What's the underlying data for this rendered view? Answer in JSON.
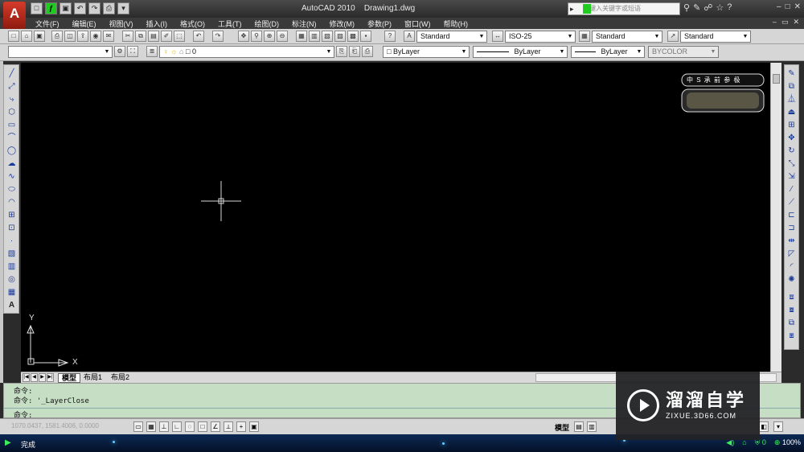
{
  "app": {
    "title": "AutoCAD 2010",
    "file": "Drawing1.dwg",
    "search_placeholder": "键入关键字或短语"
  },
  "menu": [
    "文件(F)",
    "编辑(E)",
    "视图(V)",
    "插入(I)",
    "格式(O)",
    "工具(T)",
    "绘图(D)",
    "标注(N)",
    "修改(M)",
    "参数(P)",
    "窗口(W)",
    "帮助(H)"
  ],
  "toolbar": {
    "text_style": "Standard",
    "dim_style": "ISO-25",
    "table_style": "Standard",
    "multileader_style": "Standard",
    "layer": "0",
    "color": "ByLayer",
    "linetype": "ByLayer",
    "lineweight": "ByLayer",
    "plot_style": "BYCOLOR"
  },
  "canvas": {
    "ucs_y": "Y",
    "ucs_x": "X",
    "viewcube_label": "中 S 承 前 参 极"
  },
  "tabs": [
    "模型",
    "布局1",
    "布局2"
  ],
  "command": {
    "line1": "命令:",
    "line2": "命令: '_LayerClose",
    "prompt": "命令:"
  },
  "status": {
    "coords": "1070.0437, 1581.4006, 0.0000",
    "model": "模型"
  },
  "taskbar": {
    "status": "完成",
    "tray_count": "0",
    "zoom": "100%"
  },
  "watermark": {
    "title": "溜溜自学",
    "subtitle": "ZIXUE.3D66.COM"
  },
  "colors": {
    "canvas": "#000000",
    "command_bg": "#c6dfc4",
    "titlebar": "#3a3a3a",
    "accent_green": "#1ecb1e"
  }
}
